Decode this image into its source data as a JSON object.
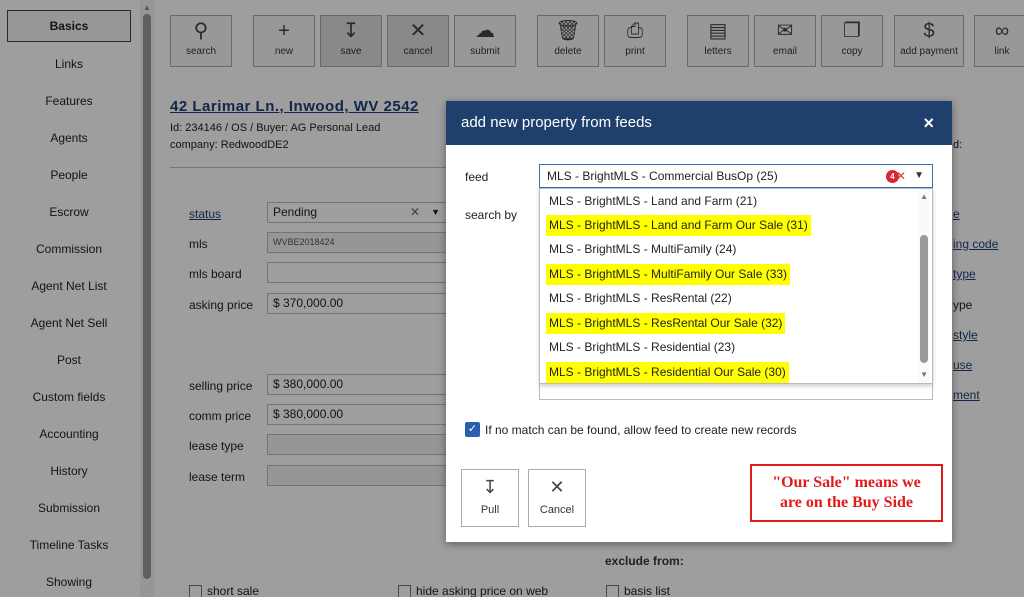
{
  "sidebar": {
    "items": [
      {
        "label": "Basics"
      },
      {
        "label": "Links"
      },
      {
        "label": "Features"
      },
      {
        "label": "Agents"
      },
      {
        "label": "People"
      },
      {
        "label": "Escrow"
      },
      {
        "label": "Commission"
      },
      {
        "label": "Agent Net List"
      },
      {
        "label": "Agent Net Sell"
      },
      {
        "label": "Post"
      },
      {
        "label": "Custom fields"
      },
      {
        "label": "Accounting"
      },
      {
        "label": "History"
      },
      {
        "label": "Submission"
      },
      {
        "label": "Timeline Tasks"
      },
      {
        "label": "Showing"
      }
    ]
  },
  "toolbar": {
    "search": "search",
    "new": "new",
    "save": "save",
    "cancel": "cancel",
    "submit": "submit",
    "delete": "delete",
    "print": "print",
    "letters": "letters",
    "email": "email",
    "copy": "copy",
    "add_payment": "add payment",
    "link": "link"
  },
  "property": {
    "title": "42 Larimar Ln., Inwood, WV 2542",
    "id_line": "Id: 234146 / OS / Buyer: AG Personal Lead",
    "company": "company: RedwoodDE2",
    "right_fragment": "d:"
  },
  "fields": {
    "status_label": "status",
    "status_value": "Pending",
    "mls_label": "mls",
    "mls_value": "WVBE2018424",
    "mls_board_label": "mls board",
    "asking_price_label": "asking price",
    "asking_price_value": "$ 370,000.00",
    "selling_price_label": "selling price",
    "selling_price_value": "$ 380,000.00",
    "comm_price_label": "comm price",
    "comm_price_value": "$ 380,000.00",
    "lease_type_label": "lease type",
    "lease_term_label": "lease term"
  },
  "right_fields": [
    "e",
    "ing code",
    "type",
    "ype",
    "style",
    "use",
    "ment"
  ],
  "modal": {
    "title": "add new property from feeds",
    "close": "×",
    "feed_label": "feed",
    "search_by_label": "search by",
    "selected_feed": "MLS - BrightMLS - Commercial BusOp (25)",
    "badge": "4",
    "options": [
      {
        "label": "MLS - BrightMLS - Land and Farm (21)",
        "highlight": false
      },
      {
        "label": "MLS - BrightMLS - Land and Farm Our Sale (31)",
        "highlight": true
      },
      {
        "label": "MLS - BrightMLS - MultiFamily (24)",
        "highlight": false
      },
      {
        "label": "MLS - BrightMLS - MultiFamily Our Sale (33)",
        "highlight": true
      },
      {
        "label": "MLS - BrightMLS - ResRental (22)",
        "highlight": false
      },
      {
        "label": "MLS - BrightMLS - ResRental Our Sale (32)",
        "highlight": true
      },
      {
        "label": "MLS - BrightMLS - Residential (23)",
        "highlight": false
      },
      {
        "label": "MLS - BrightMLS - Residential Our Sale (30)",
        "highlight": true
      }
    ],
    "allow_create_label": "If no match can be found, allow feed to create new records",
    "allow_create_checked": true,
    "pull_label": "Pull",
    "cancel_label": "Cancel"
  },
  "annotation": {
    "line1": "\"Our Sale\" means we",
    "line2": "are on the Buy Side"
  },
  "bottom": {
    "exclude_from": "exclude from:",
    "short_sale": "short sale",
    "hide_asking_price": "hide asking price on web",
    "basis_list": "basis list"
  },
  "colors": {
    "modal_header": "#1f3f6c",
    "highlight": "#ffff00",
    "annotation_red": "#e01b1b",
    "link_blue": "#1f3f7a"
  }
}
